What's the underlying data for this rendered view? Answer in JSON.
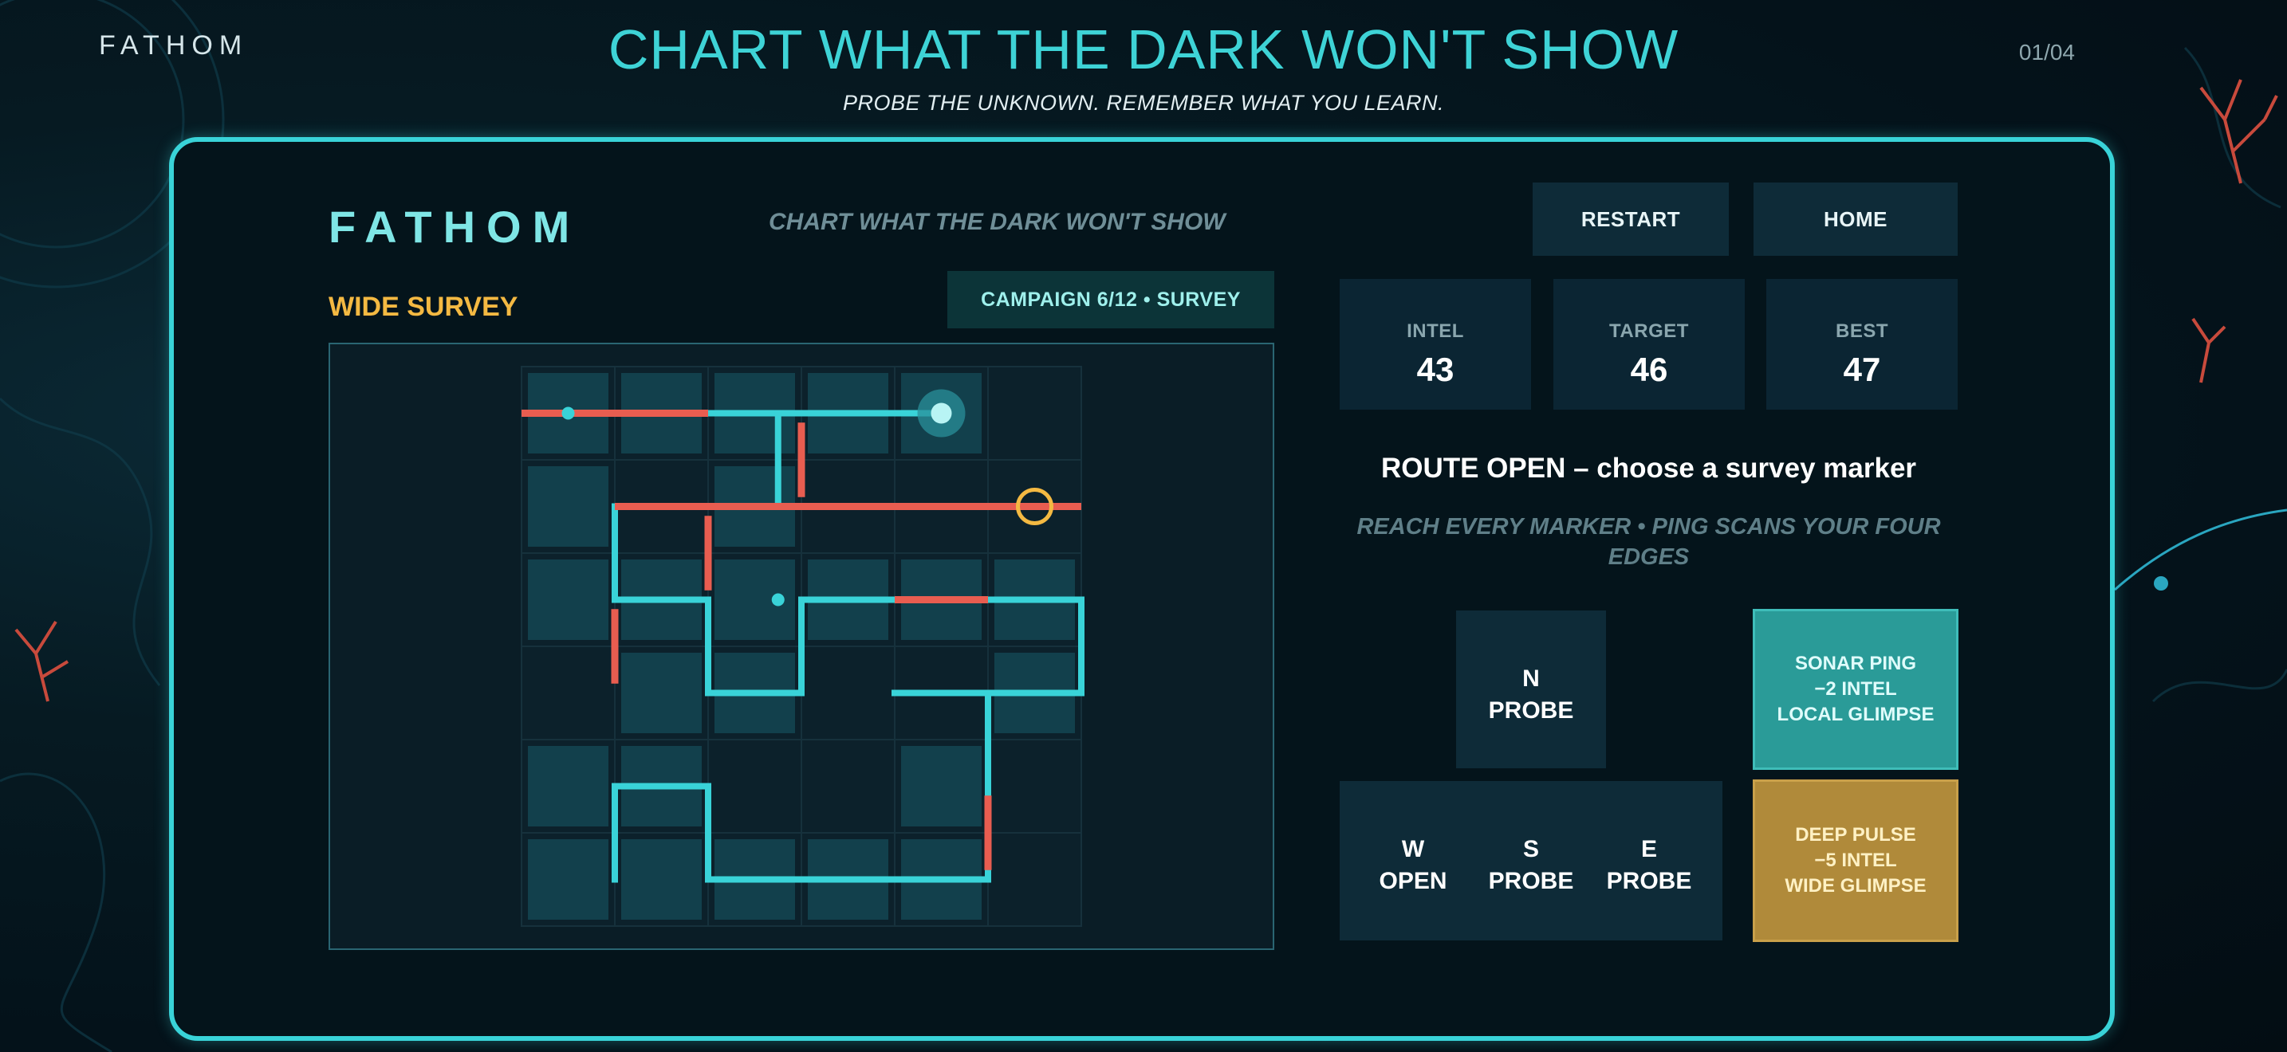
{
  "header": {
    "brand": "FATHOM",
    "title": "CHART WHAT THE DARK WON'T SHOW",
    "subtitle": "PROBE THE UNKNOWN. REMEMBER WHAT YOU LEARN.",
    "page": "01/04"
  },
  "game": {
    "brand": "FATHOM",
    "tagline": "CHART WHAT THE DARK WON'T SHOW",
    "restart_label": "RESTART",
    "home_label": "HOME",
    "level_name": "WIDE SURVEY",
    "campaign": "CAMPAIGN  6/12  •  SURVEY",
    "stats": {
      "intel_label": "INTEL",
      "intel_value": "43",
      "target_label": "TARGET",
      "target_value": "46",
      "best_label": "BEST",
      "best_value": "47"
    },
    "status": "ROUTE OPEN – choose a survey marker",
    "hint": "REACH EVERY MARKER  •  PING SCANS YOUR FOUR EDGES",
    "directions": {
      "n": {
        "dir": "N",
        "state": "PROBE"
      },
      "w": {
        "dir": "W",
        "state": "OPEN"
      },
      "s": {
        "dir": "S",
        "state": "PROBE"
      },
      "e": {
        "dir": "E",
        "state": "PROBE"
      }
    },
    "actions": {
      "sonar": {
        "line1": "SONAR PING",
        "line2": "−2 INTEL",
        "line3": "LOCAL GLIMPSE"
      },
      "deep": {
        "line1": "DEEP PULSE",
        "line2": "−5 INTEL",
        "line3": "WIDE GLIMPSE"
      }
    },
    "colors": {
      "accent": "#39d3d8",
      "wall": "#e85d50",
      "marker": "#f4b942",
      "tile": "#12404c"
    },
    "board": {
      "cols": 6,
      "rows": 6,
      "revealed": [
        [
          0,
          0
        ],
        [
          1,
          0
        ],
        [
          2,
          0
        ],
        [
          3,
          0
        ],
        [
          4,
          0
        ],
        [
          0,
          1
        ],
        [
          2,
          1
        ],
        [
          0,
          2
        ],
        [
          1,
          2
        ],
        [
          2,
          2
        ],
        [
          3,
          2
        ],
        [
          4,
          2
        ],
        [
          5,
          2
        ],
        [
          1,
          3
        ],
        [
          2,
          3
        ],
        [
          5,
          3
        ],
        [
          0,
          4
        ],
        [
          1,
          4
        ],
        [
          4,
          4
        ],
        [
          0,
          5
        ],
        [
          1,
          5
        ],
        [
          2,
          5
        ],
        [
          3,
          5
        ],
        [
          4,
          5
        ]
      ],
      "path_start": [
        0,
        0
      ],
      "player": [
        4,
        0
      ],
      "marker": [
        5,
        1
      ],
      "paths": [
        [
          [
            0,
            0
          ],
          [
            4,
            0
          ]
        ],
        [
          [
            2.25,
            0
          ],
          [
            2.25,
            1
          ],
          [
            0.5,
            1
          ],
          [
            0.5,
            2
          ],
          [
            1.5,
            2
          ],
          [
            1.5,
            3
          ],
          [
            2.5,
            3
          ],
          [
            2.5,
            2
          ],
          [
            5.5,
            2
          ],
          [
            5.5,
            3
          ],
          [
            4.5,
            3
          ],
          [
            4.5,
            5
          ],
          [
            1.5,
            5
          ],
          [
            1.5,
            4
          ],
          [
            0.5,
            4
          ],
          [
            0.5,
            5
          ]
        ],
        [
          [
            4.5,
            3
          ],
          [
            3.5,
            3
          ]
        ]
      ],
      "walls": [
        [
          [
            0,
            0.5
          ],
          [
            1,
            0.5
          ]
        ],
        [
          [
            1,
            0.5
          ],
          [
            2,
            0.5
          ]
        ],
        [
          [
            3,
            0.6
          ],
          [
            3,
            1.4
          ]
        ],
        [
          [
            1,
            1.5
          ],
          [
            2,
            1.5
          ]
        ],
        [
          [
            2,
            1.5
          ],
          [
            3,
            1.5
          ]
        ],
        [
          [
            3,
            1.5
          ],
          [
            4,
            1.5
          ]
        ],
        [
          [
            4,
            1.5
          ],
          [
            5,
            1.5
          ]
        ],
        [
          [
            5,
            1.5
          ],
          [
            6,
            1.5
          ]
        ],
        [
          [
            2,
            1.6
          ],
          [
            2,
            2.4
          ]
        ],
        [
          [
            4,
            2.5
          ],
          [
            5,
            2.5
          ]
        ],
        [
          [
            1,
            2.6
          ],
          [
            1,
            3.4
          ]
        ],
        [
          [
            5,
            4.6
          ],
          [
            5,
            5.4
          ]
        ]
      ]
    }
  }
}
